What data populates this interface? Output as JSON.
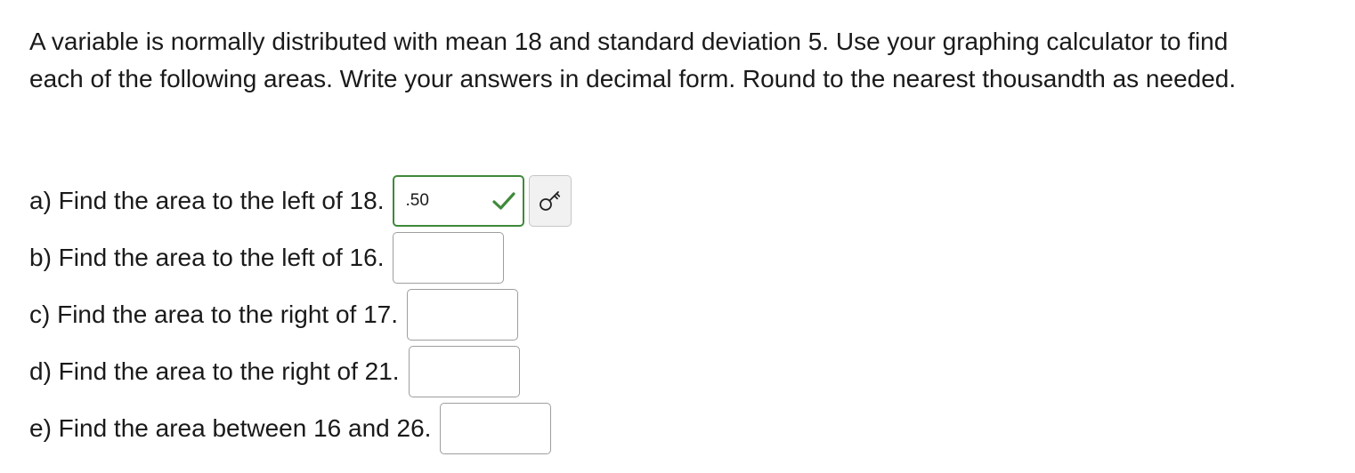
{
  "instructions": "A variable is normally distributed with mean 18 and standard deviation 5. Use your graphing calculator to find each of the following areas. Write your answers in decimal form. Round to the nearest thousandth as needed.",
  "questions": [
    {
      "label": "a) Find the area to the left of 18.",
      "answer": ".50",
      "status": "correct"
    },
    {
      "label": "b) Find the area to the left of 16.",
      "answer": ""
    },
    {
      "label": "c) Find the area to the right of 17.",
      "answer": ""
    },
    {
      "label": "d) Find the area to the right of 21.",
      "answer": ""
    },
    {
      "label": "e) Find the area between 16 and 26.",
      "answer": ""
    }
  ],
  "icons": {
    "correct": "checkmark-icon",
    "key": "key-icon"
  },
  "colors": {
    "correct": "#3f8a3a",
    "box_border": "#9e9e9e",
    "key_button_bg": "#f1f1f1"
  }
}
